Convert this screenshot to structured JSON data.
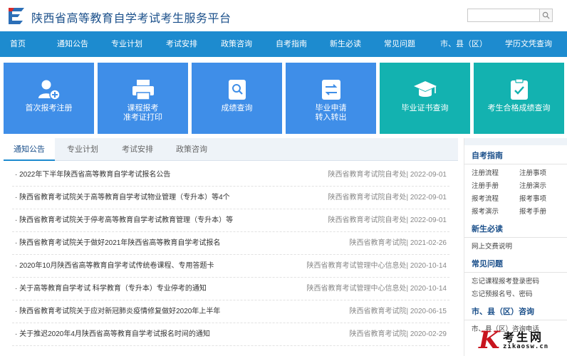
{
  "header": {
    "site_title": "陕西省高等教育自学考试考生服务平台",
    "search_placeholder": ""
  },
  "nav": [
    {
      "label": "首页"
    },
    {
      "label": "通知公告"
    },
    {
      "label": "专业计划"
    },
    {
      "label": "考试安排"
    },
    {
      "label": "政策咨询"
    },
    {
      "label": "自考指南"
    },
    {
      "label": "新生必读"
    },
    {
      "label": "常见问题"
    },
    {
      "label": "市、县（区）咨询"
    },
    {
      "label": "学历文凭查询"
    }
  ],
  "tiles": [
    {
      "line1": "首次报考注册",
      "line2": "",
      "icon": "user-add-icon",
      "color": "#3f8ee8"
    },
    {
      "line1": "课程报考",
      "line2": "准考证打印",
      "icon": "printer-icon",
      "color": "#3f8ee8"
    },
    {
      "line1": "成绩查询",
      "line2": "",
      "icon": "search-doc-icon",
      "color": "#3f8ee8"
    },
    {
      "line1": "毕业申请",
      "line2": "转入转出",
      "icon": "transfer-icon",
      "color": "#3f8ee8"
    },
    {
      "line1": "毕业证书查询",
      "line2": "",
      "icon": "graduation-cap-icon",
      "color": "#13b2b0"
    },
    {
      "line1": "考生合格成绩查询",
      "line2": "",
      "icon": "checklist-icon",
      "color": "#13b2b0"
    }
  ],
  "tabs": [
    {
      "label": "通知公告"
    },
    {
      "label": "专业计划"
    },
    {
      "label": "考试安排"
    },
    {
      "label": "政策咨询"
    }
  ],
  "news": [
    {
      "title": "· 2022年下半年陕西省高等教育自学考试报名公告",
      "meta": "陕西省教育考试院自考处| 2022-09-01"
    },
    {
      "title": "· 陕西省教育考试院关于高等教育自学考试物业管理（专升本）等4个",
      "meta": "陕西省教育考试院自考处| 2022-09-01"
    },
    {
      "title": "· 陕西省教育考试院关于停考高等教育自学考试教育管理（专升本）等",
      "meta": "陕西省教育考试院自考处| 2022-09-01"
    },
    {
      "title": "· 陕西省教育考试院关于做好2021年陕西省高等教育自学考试报名",
      "meta": "陕西省教育考试院| 2021-02-26"
    },
    {
      "title": "· 2020年10月陕西省高等教育自学考试传统卷课程、专用答题卡",
      "meta": "陕西省教育考试管理中心信息处| 2020-10-14"
    },
    {
      "title": "· 关于高等教育自学考试 科学教育（专升本）专业停考的通知",
      "meta": "陕西省教育考试管理中心信息处| 2020-10-14"
    },
    {
      "title": "· 陕西省教育考试院关于应对新冠肺炎疫情修复做好2020年上半年",
      "meta": "陕西省教育考试院| 2020-06-15"
    },
    {
      "title": "· 关于推迟2020年4月陕西省高等教育自学考试报名时间的通知",
      "meta": "陕西省教育考试院| 2020-02-29"
    }
  ],
  "sidebar": {
    "sections": [
      {
        "heading": "自考指南",
        "links": [
          "注册流程",
          "注册事项",
          "注册手册",
          "注册演示",
          "报考流程",
          "报考事项",
          "报考演示",
          "报考手册"
        ]
      },
      {
        "heading": "新生必读",
        "links": [
          "网上交费说明"
        ]
      },
      {
        "heading": "常见问题",
        "links": [
          "忘记课程报考登录密码",
          "忘记预报名号、密码"
        ]
      },
      {
        "heading": "市、县（区）咨询",
        "links": [
          "市、县（区）咨询电话"
        ]
      }
    ]
  },
  "watermark": {
    "letter": "K",
    "text": "考生网",
    "url": "zikaosw.cn"
  },
  "colors": {
    "nav_bg": "#1d8bcf",
    "tile_blue": "#3f8ee8",
    "tile_teal": "#13b2b0",
    "title_color": "#1a4f8a"
  }
}
